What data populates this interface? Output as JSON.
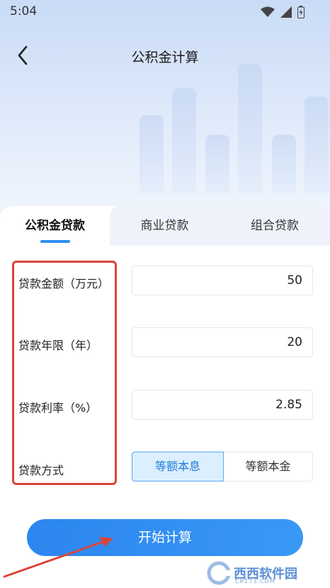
{
  "status_bar": {
    "time": "5:04"
  },
  "header": {
    "title": "公积金计算"
  },
  "tabs": [
    {
      "label": "公积金贷款",
      "active": true
    },
    {
      "label": "商业贷款",
      "active": false
    },
    {
      "label": "组合贷款",
      "active": false
    }
  ],
  "form": {
    "amount": {
      "label": "贷款金额（万元）",
      "value": "50"
    },
    "years": {
      "label": "贷款年限（年）",
      "value": "20"
    },
    "rate": {
      "label": "贷款利率（%）",
      "value": "2.85"
    },
    "method": {
      "label": "贷款方式",
      "options": [
        "等额本息",
        "等额本金"
      ],
      "selected": "等额本息"
    }
  },
  "action": {
    "calculate_label": "开始计算"
  },
  "watermark": {
    "text": "西西软件园",
    "sub": "CR173.COM"
  },
  "colors": {
    "accent": "#2e8ef0",
    "annotation": "#d9453a"
  }
}
